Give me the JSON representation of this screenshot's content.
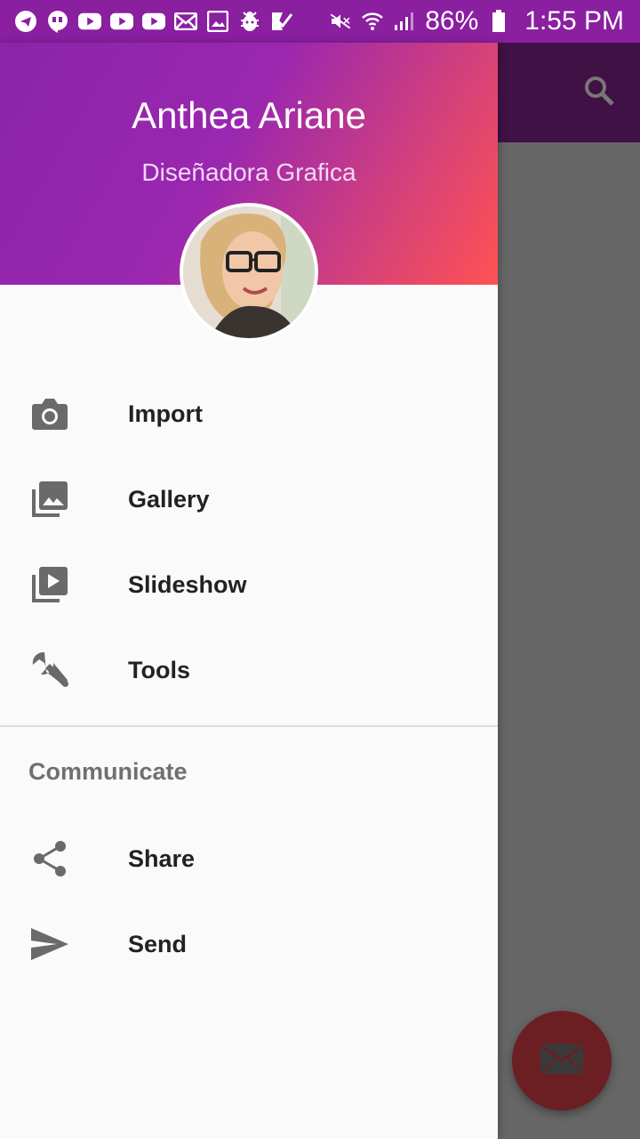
{
  "status_bar": {
    "battery": "86%",
    "time": "1:55 PM",
    "left_icons": [
      "telegram-icon",
      "hangouts-icon",
      "youtube-icon",
      "youtube-icon",
      "youtube-icon",
      "mail-icon",
      "image-icon",
      "bug-icon",
      "check-icon"
    ],
    "right_icons": [
      "mute-icon",
      "wifi-icon",
      "signal-icon",
      "battery-icon"
    ]
  },
  "drawer": {
    "user_name": "Anthea Ariane",
    "user_role": "Diseñadora Grafica",
    "main_items": [
      {
        "label": "Import",
        "icon": "camera-icon"
      },
      {
        "label": "Gallery",
        "icon": "photo-library-icon"
      },
      {
        "label": "Slideshow",
        "icon": "slideshow-icon"
      },
      {
        "label": "Tools",
        "icon": "wrench-icon"
      }
    ],
    "section_title": "Communicate",
    "communicate_items": [
      {
        "label": "Share",
        "icon": "share-icon"
      },
      {
        "label": "Send",
        "icon": "send-icon"
      }
    ]
  },
  "colors": {
    "status_bar": "#8a1fa0",
    "app_bar": "#401144",
    "header_gradient_start": "#8b24a8",
    "header_gradient_end": "#ff5252",
    "fab": "#6b1f23",
    "scrim": "#666666"
  }
}
